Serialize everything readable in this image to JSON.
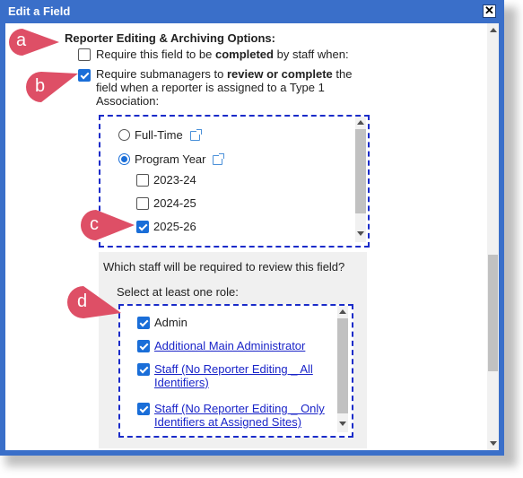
{
  "window": {
    "title": "Edit a Field",
    "close_glyph": "✕"
  },
  "section_title": "Reporter Editing & Archiving Options:",
  "options": [
    {
      "pre": "Require this field to be ",
      "bold": "completed",
      "post": " by staff when:",
      "checked": false
    },
    {
      "pre": "Require submanagers to ",
      "bold": "review or complete",
      "post": " the",
      "line2": "field when a reporter is assigned to a Type 1",
      "line3": "Association:",
      "checked": true
    }
  ],
  "association": {
    "radios": [
      {
        "label": "Full-Time",
        "selected": false,
        "icon": "external-link-icon"
      },
      {
        "label": "Program Year",
        "selected": true,
        "icon": "external-link-icon"
      }
    ],
    "years": [
      {
        "label": "2023-24",
        "checked": false
      },
      {
        "label": "2024-25",
        "checked": false
      },
      {
        "label": "2025-26",
        "checked": true
      }
    ]
  },
  "staff_review": {
    "question": "Which staff will be required to review this field?",
    "instruction": "Select at least one role:",
    "roles": [
      {
        "label": "Admin",
        "checked": true,
        "link": false
      },
      {
        "label": "Additional Main Administrator",
        "checked": true,
        "link": true
      },
      {
        "label": "Staff (No Reporter Editing _ All",
        "line2": "Identifiers)",
        "checked": true,
        "link": true
      },
      {
        "label": "Staff (No Reporter Editing _ Only",
        "line2": "Identifiers at Assigned Sites)",
        "checked": true,
        "link": true
      }
    ]
  },
  "callouts": [
    "a",
    "b",
    "c",
    "d"
  ],
  "colors": {
    "titlebar": "#3a6fc9",
    "callout": "#de4f66",
    "dashed_border": "#1a2bc9",
    "link": "#1a24c8",
    "checkbox_checked": "#1a6ed8"
  }
}
